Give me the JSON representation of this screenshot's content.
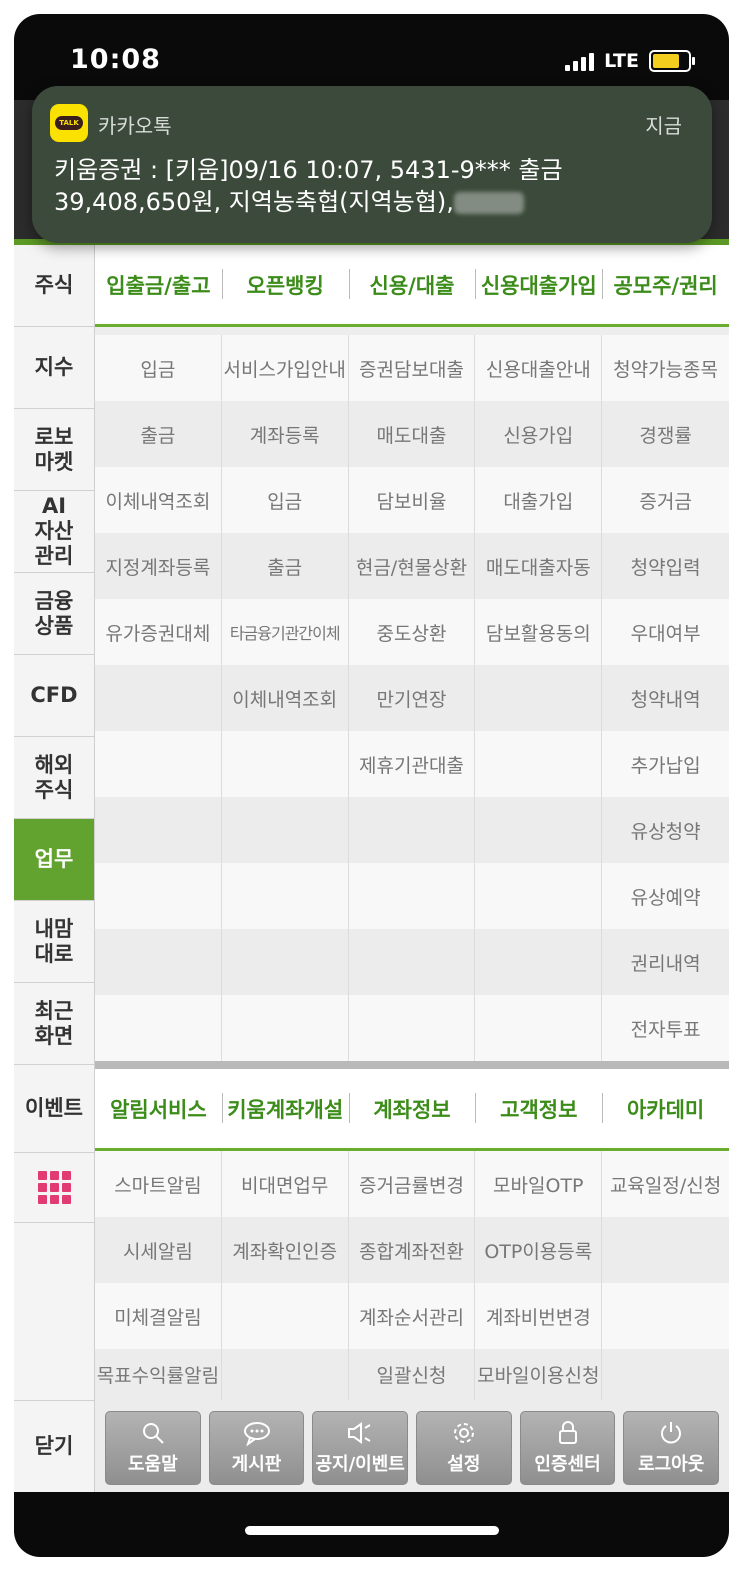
{
  "status": {
    "time": "10:08",
    "network": "LTE"
  },
  "notification": {
    "app": "카카오톡",
    "time": "지금",
    "icon_label": "TALK",
    "line1": "키움증권 : [키움]09/16 10:07, 5431-9*** 출금",
    "line2": "39,408,650원, 지역농축협(지역농협),"
  },
  "sidebar": {
    "items": [
      "주식",
      "지수",
      "로보\n마켓",
      "AI\n자산\n관리",
      "금융\n상품",
      "CFD",
      "해외\n주식",
      "업무",
      "내맘\n대로",
      "최근\n화면",
      "이벤트"
    ],
    "close": "닫기"
  },
  "section1": {
    "headers": [
      "입출금/출고",
      "오픈뱅킹",
      "신용/대출",
      "신용대출가입",
      "공모주/권리"
    ],
    "rows": [
      [
        "입금",
        "서비스가입안내",
        "증권담보대출",
        "신용대출안내",
        "청약가능종목"
      ],
      [
        "출금",
        "계좌등록",
        "매도대출",
        "신용가입",
        "경쟁률"
      ],
      [
        "이체내역조회",
        "입금",
        "담보비율",
        "대출가입",
        "증거금"
      ],
      [
        "지정계좌등록",
        "출금",
        "현금/현물상환",
        "매도대출자동",
        "청약입력"
      ],
      [
        "유가증권대체",
        "타금융기관간이체",
        "중도상환",
        "담보활용동의",
        "우대여부"
      ],
      [
        "",
        "이체내역조회",
        "만기연장",
        "",
        "청약내역"
      ],
      [
        "",
        "",
        "제휴기관대출",
        "",
        "추가납입"
      ],
      [
        "",
        "",
        "",
        "",
        "유상청약"
      ],
      [
        "",
        "",
        "",
        "",
        "유상예약"
      ],
      [
        "",
        "",
        "",
        "",
        "권리내역"
      ],
      [
        "",
        "",
        "",
        "",
        "전자투표"
      ]
    ]
  },
  "section2": {
    "headers": [
      "알림서비스",
      "키움계좌개설",
      "계좌정보",
      "고객정보",
      "아카데미"
    ],
    "rows": [
      [
        "스마트알림",
        "비대면업무",
        "증거금률변경",
        "모바일OTP",
        "교육일정/신청"
      ],
      [
        "시세알림",
        "계좌확인인증",
        "종합계좌전환",
        "OTP이용등록",
        ""
      ],
      [
        "미체결알림",
        "",
        "계좌순서관리",
        "계좌비번변경",
        ""
      ],
      [
        "목표수익률알림",
        "",
        "일괄신청",
        "모바일이용신청",
        ""
      ]
    ]
  },
  "bottom_buttons": [
    {
      "label": "도움말",
      "icon": "search-icon"
    },
    {
      "label": "게시판",
      "icon": "chat-icon"
    },
    {
      "label": "공지/이벤트",
      "icon": "speaker-icon"
    },
    {
      "label": "설정",
      "icon": "gear-icon"
    },
    {
      "label": "인증센터",
      "icon": "lock-icon"
    },
    {
      "label": "로그아웃",
      "icon": "power-icon"
    }
  ]
}
